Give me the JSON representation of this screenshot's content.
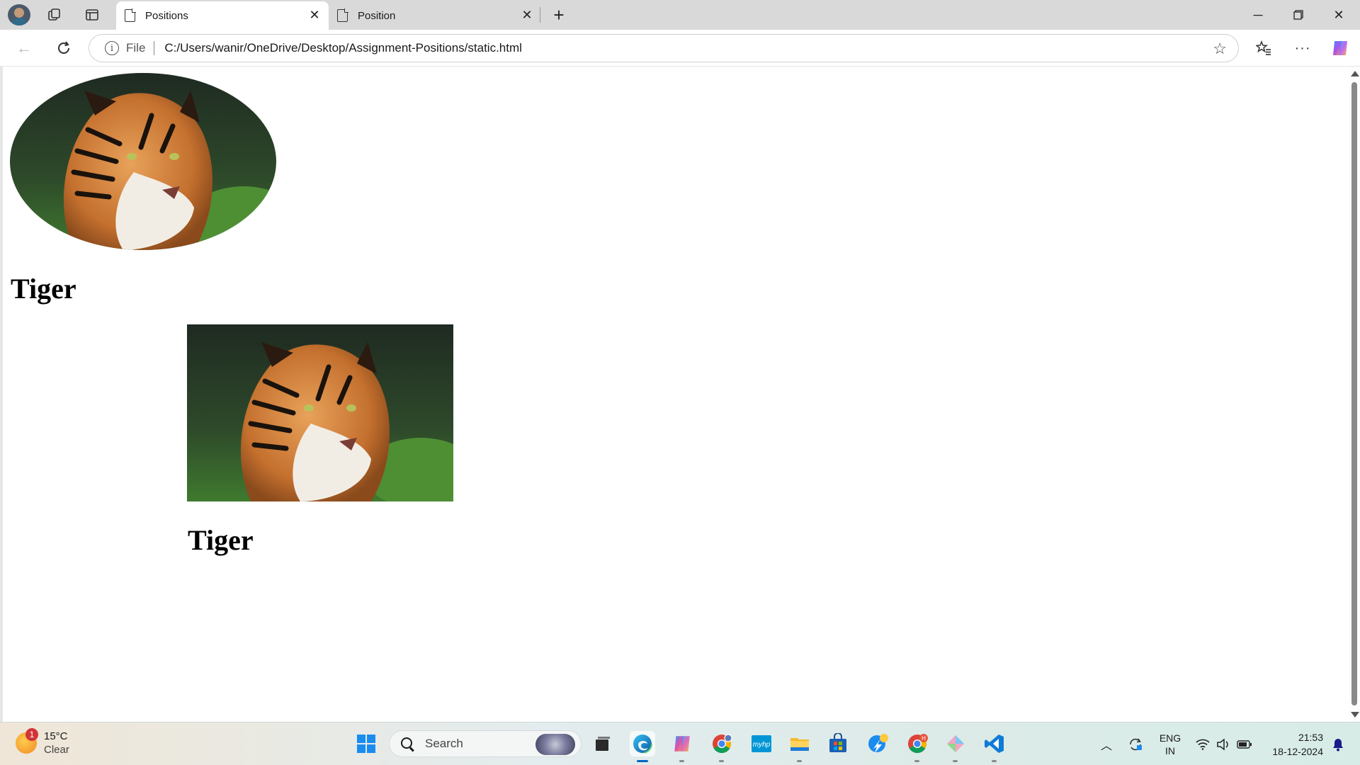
{
  "browser": {
    "tabs": [
      {
        "title": "Positions",
        "active": true
      },
      {
        "title": "Position",
        "active": false
      }
    ],
    "address": {
      "scheme_label": "File",
      "url": "C:/Users/wanir/OneDrive/Desktop/Assignment-Positions/static.html"
    },
    "icons": [
      "profile-avatar",
      "workspaces-icon",
      "vertical-tabs-icon",
      "new-tab-icon",
      "back-icon",
      "reload-icon",
      "info-icon",
      "favorite-star-icon",
      "favorites-icon",
      "more-icon",
      "copilot-icon"
    ]
  },
  "page": {
    "heading_1": "Tiger",
    "heading_2": "Tiger"
  },
  "taskbar": {
    "weather": {
      "temperature": "15°C",
      "condition": "Clear",
      "badge": "1"
    },
    "search_placeholder": "Search",
    "apps": [
      "start",
      "search",
      "task-view",
      "edge",
      "copilot",
      "chrome",
      "myhp",
      "file-explorer",
      "microsoft-store",
      "chrome-profile",
      "chrome-h",
      "app",
      "vscode"
    ],
    "language": {
      "line1": "ENG",
      "line2": "IN"
    },
    "clock": {
      "time": "21:53",
      "date": "18-12-2024"
    }
  }
}
